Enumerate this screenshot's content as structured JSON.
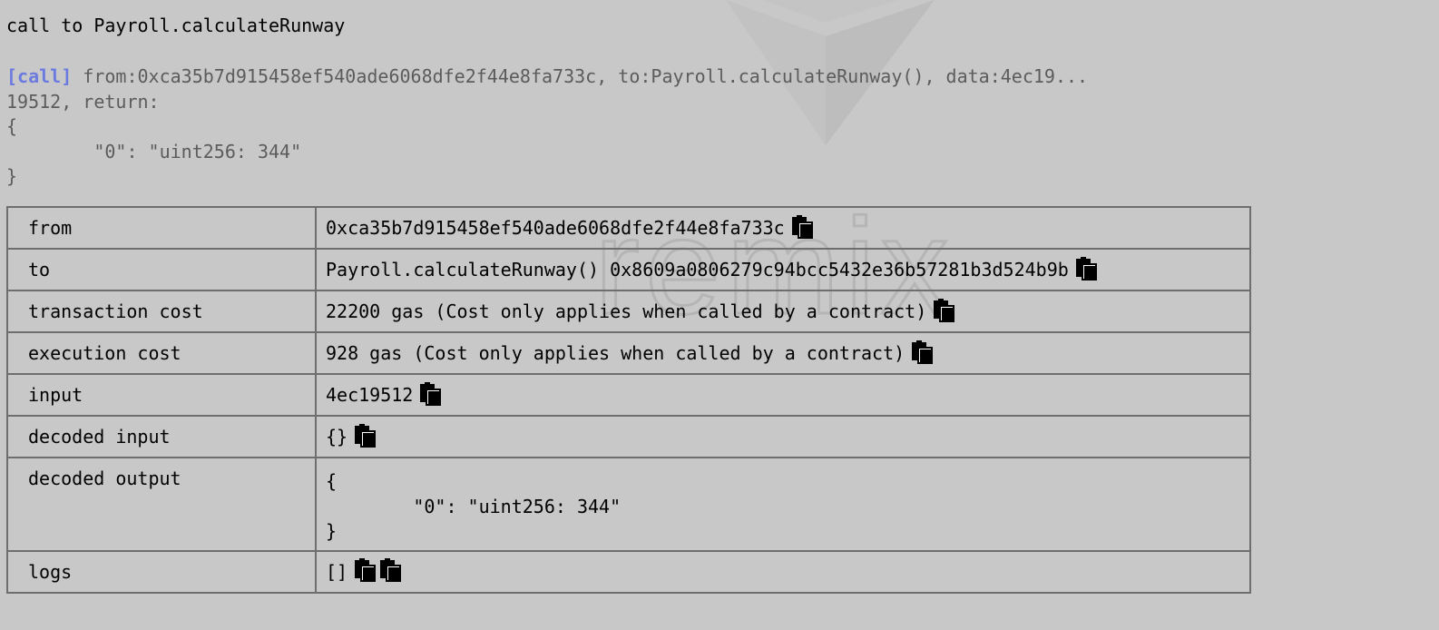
{
  "title": "call to Payroll.calculateRunway",
  "log": {
    "tag": "[call]",
    "line1": " from:0xca35b7d915458ef540ade6068dfe2f44e8fa733c, to:Payroll.calculateRunway(), data:4ec19...",
    "line2": "19512, return:",
    "line3": "{",
    "line4": "        \"0\": \"uint256: 344\"",
    "line5": "}"
  },
  "rows": [
    {
      "key": "from",
      "value": "0xca35b7d915458ef540ade6068dfe2f44e8fa733c"
    },
    {
      "key": "to",
      "value": "Payroll.calculateRunway() 0x8609a0806279c94bcc5432e36b57281b3d524b9b"
    },
    {
      "key": "transaction cost",
      "value": "22200 gas (Cost only applies when called by a contract)"
    },
    {
      "key": "execution cost",
      "value": "928 gas (Cost only applies when called by a contract)"
    },
    {
      "key": "input",
      "value": "4ec19512"
    },
    {
      "key": "decoded input",
      "value": "{}"
    },
    {
      "key": "decoded output",
      "value": "{\n        \"0\": \"uint256: 344\"\n}"
    },
    {
      "key": "logs",
      "value": "[]"
    }
  ],
  "icons": {
    "copy": "clipboard-copy-icon"
  },
  "watermark": {
    "text": "remix"
  }
}
